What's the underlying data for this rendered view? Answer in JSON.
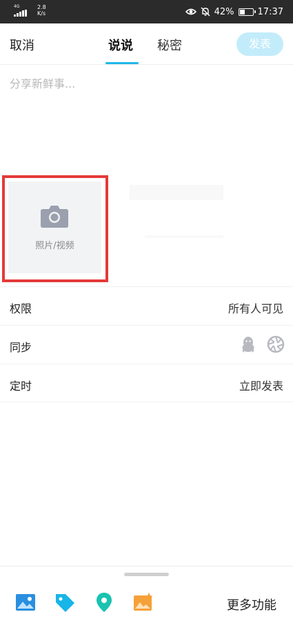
{
  "status_bar": {
    "network": "4G",
    "net_speed_value": "2.8",
    "net_speed_unit": "K/s",
    "battery_percent": "42%",
    "battery_level": 0.42,
    "time": "17:37"
  },
  "header": {
    "cancel_label": "取消",
    "tabs": [
      {
        "label": "说说",
        "active": true
      },
      {
        "label": "秘密",
        "active": false
      }
    ],
    "publish_label": "发表"
  },
  "composer": {
    "value": "",
    "placeholder": "分享新鲜事..."
  },
  "media": {
    "add_label": "照片/视频"
  },
  "options": [
    {
      "label": "权限",
      "value": "所有人可见"
    },
    {
      "label": "同步",
      "value": "",
      "icons": [
        "qq-penguin-icon",
        "camera-shutter-icon"
      ]
    },
    {
      "label": "定时",
      "value": "立即发表"
    }
  ],
  "toolbar": {
    "icons": [
      "image-icon",
      "tag-icon",
      "location-icon",
      "photo-edit-icon"
    ],
    "more_label": "更多功能"
  },
  "colors": {
    "accent": "#1fb8e8",
    "publish_disabled": "#c3ecfa",
    "highlight": "#e53939",
    "image_icon": "#2a8fe0",
    "tag_icon": "#18b5e8",
    "location_icon": "#19c3b0",
    "photo_edit_icon": "#f5a13a"
  }
}
